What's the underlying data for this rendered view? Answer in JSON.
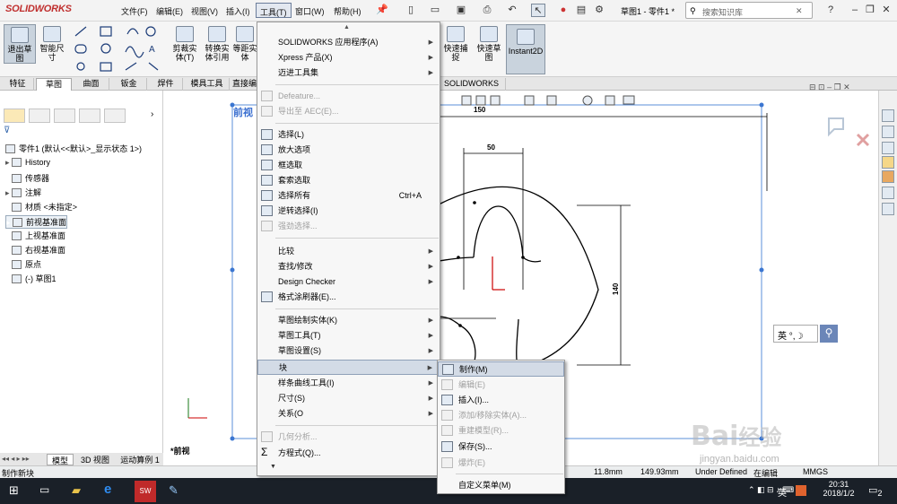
{
  "app": {
    "logo": "SOLIDWORKS",
    "doc_title": "草图1 - 零件1 *",
    "search_placeholder": "搜索知识库"
  },
  "menubar": [
    "文件(F)",
    "编辑(E)",
    "视图(V)",
    "插入(I)",
    "工具(T)",
    "窗口(W)",
    "帮助(H)"
  ],
  "ribbon": [
    {
      "label": "退出草\n图"
    },
    {
      "label": "智能尺\n寸"
    },
    {
      "label": "剪裁实\n体(T)"
    },
    {
      "label": "转换实\n体引用"
    },
    {
      "label": "等距实\n体"
    },
    {
      "label": "快速捕\n捉"
    },
    {
      "label": "快速草\n图"
    },
    {
      "label": "Instant2D"
    }
  ],
  "tabs": [
    "特征",
    "草图",
    "曲面",
    "钣金",
    "焊件",
    "模具工具",
    "直接编",
    "SOLIDWORKS MBD"
  ],
  "tree": {
    "root": "零件1 (默认<<默认>_显示状态 1>)",
    "items": [
      "History",
      "传感器",
      "注解",
      "材质 <未指定>",
      "前视基准面",
      "上视基准面",
      "右视基准面",
      "原点",
      "(-) 草图1"
    ]
  },
  "viewport": {
    "view_label": "前视",
    "view_label_bottom": "*前视",
    "dims": {
      "d150": "150",
      "d50": "50",
      "d140": "140"
    },
    "ime": "英"
  },
  "tools_menu": {
    "items": [
      {
        "label": "SOLIDWORKS 应用程序(A)",
        "arrow": true
      },
      {
        "label": "Xpress 产品(X)",
        "arrow": true
      },
      {
        "label": "迈进工具集",
        "arrow": true
      },
      {
        "label": "Defeature...",
        "disabled": true
      },
      {
        "label": "导出至 AEC(E)...",
        "disabled": true
      },
      {
        "label": "选择(L)"
      },
      {
        "label": "放大选项"
      },
      {
        "label": "框选取"
      },
      {
        "label": "套索选取"
      },
      {
        "label": "选择所有",
        "shortcut": "Ctrl+A"
      },
      {
        "label": "逆转选择(I)"
      },
      {
        "label": "强劲选择...",
        "disabled": true
      },
      {
        "label": "比较",
        "arrow": true
      },
      {
        "label": "查找/修改",
        "arrow": true
      },
      {
        "label": "Design Checker",
        "arrow": true
      },
      {
        "label": "格式涂刷器(E)..."
      },
      {
        "label": "草图绘制实体(K)",
        "arrow": true
      },
      {
        "label": "草图工具(T)",
        "arrow": true
      },
      {
        "label": "草图设置(S)",
        "arrow": true
      },
      {
        "label": "块",
        "arrow": true
      },
      {
        "label": "样条曲线工具(I)",
        "arrow": true
      },
      {
        "label": "尺寸(S)",
        "arrow": true
      },
      {
        "label": "关系(O",
        "arrow": true
      },
      {
        "label": "几何分析...",
        "disabled": true
      },
      {
        "label": "方程式(Q)..."
      }
    ]
  },
  "block_submenu": {
    "items": [
      {
        "label": "制作(M)"
      },
      {
        "label": "编辑(E)",
        "disabled": true
      },
      {
        "label": "插入(I)..."
      },
      {
        "label": "添加/移除实体(A)...",
        "disabled": true
      },
      {
        "label": "重建模型(R)...",
        "disabled": true
      },
      {
        "label": "保存(S)..."
      },
      {
        "label": "爆炸(E)",
        "disabled": true
      },
      {
        "label": "自定义菜单(M)"
      }
    ]
  },
  "bottom_tabs": [
    "模型",
    "3D 视图",
    "运动算例 1"
  ],
  "status": {
    "left": "制作新块",
    "x": "11.8mm",
    "y": "149.93mm",
    "state": "Under Defined",
    "edit": "在编辑",
    "units": "MMGS"
  },
  "taskbar": {
    "time": "20:31",
    "date": "2018/1/2",
    "ime": "英",
    "badge": "2"
  },
  "watermark": {
    "brand": "Bai",
    "sub": "jingyan.baidu.com",
    "cn": "经验"
  },
  "colors": {
    "accent": "#c0302f",
    "highlight": "#d3dbe6",
    "sketch_blue": "#1a5fd6"
  }
}
